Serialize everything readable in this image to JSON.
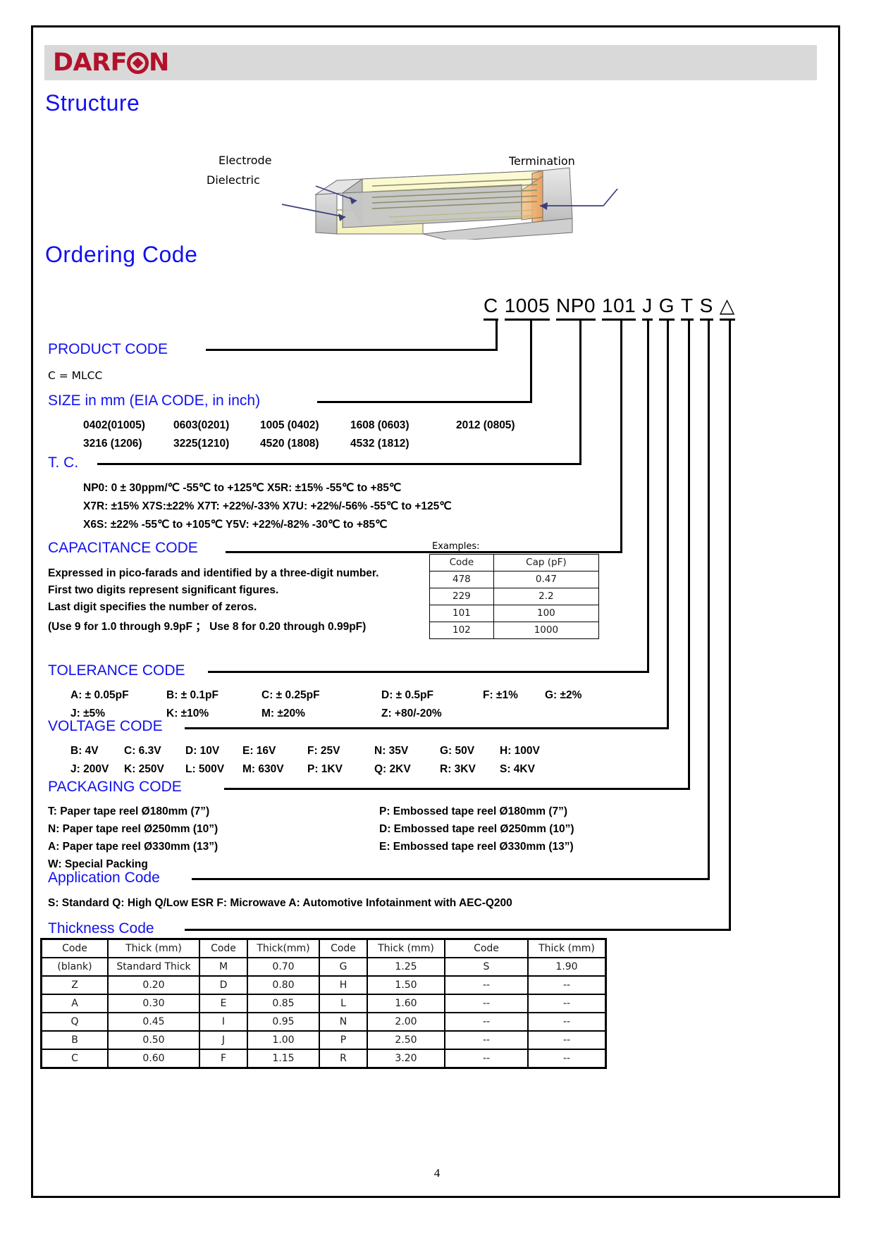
{
  "brand": {
    "name_part1": "DARF",
    "name_part2": "N"
  },
  "headings": {
    "structure": "Structure",
    "ordering_code": "Ordering Code"
  },
  "structure_diagram": {
    "labels": {
      "electrode": "Electrode",
      "dielectric": "Dielectric",
      "termination": "Termination"
    }
  },
  "ordering_code": {
    "segments": [
      "C",
      "1005",
      "NP0",
      "101",
      "J",
      "G",
      "T",
      "S",
      "△"
    ]
  },
  "sections": {
    "product_code": {
      "title": "PRODUCT CODE",
      "lines": [
        "C  =  MLCC"
      ]
    },
    "size": {
      "title": "SIZE in mm (EIA CODE, in inch)",
      "row1": [
        "0402(01005)",
        "0603(0201)",
        "1005 (0402)",
        "1608 (0603)",
        "2012 (0805)"
      ],
      "row2": [
        "3216 (1206)",
        "3225(1210)",
        "4520 (1808)",
        "4532 (1812)"
      ]
    },
    "tc": {
      "title": "T. C.",
      "line1": "NP0: 0 ± 30ppm/℃    -55℃  to +125℃          X5R: ±15%     -55℃  to +85℃",
      "line2": "X7R: ±15%    X7S:±22%   X7T: +22%/-33%   X7U: +22%/-56%    -55℃  to +125℃",
      "line3": "X6S: ±22%      -55℃  to +105℃        Y5V: +22%/-82%    -30℃  to +85℃"
    },
    "capacitance": {
      "title": "CAPACITANCE CODE",
      "line1": "Expressed in pico-farads and identified by a three-digit number.",
      "line2": "First two digits represent significant figures.",
      "line3": "Last digit specifies the number of zeros.",
      "line4": "(Use 9 for 1.0 through 9.9pF ；  Use 8 for 0.20 through 0.99pF)",
      "examples_caption": "Examples:",
      "examples_headers": [
        "Code",
        "Cap (pF)"
      ],
      "examples_rows": [
        [
          "478",
          "0.47"
        ],
        [
          "229",
          "2.2"
        ],
        [
          "101",
          "100"
        ],
        [
          "102",
          "1000"
        ]
      ]
    },
    "tolerance": {
      "title": "TOLERANCE CODE",
      "row1": [
        "A: ± 0.05pF",
        "B: ± 0.1pF",
        "C: ± 0.25pF",
        "D: ± 0.5pF",
        "F: ±1%",
        "G: ±2%"
      ],
      "row2": [
        "J: ±5%",
        "K: ±10%",
        "M: ±20%",
        "Z: +80/-20%"
      ]
    },
    "voltage": {
      "title": "VOLTAGE CODE",
      "row1": [
        "B: 4V",
        "C: 6.3V",
        "D: 10V",
        "E: 16V",
        "F: 25V",
        "N: 35V",
        "G: 50V",
        "H: 100V"
      ],
      "row2": [
        "J: 200V",
        "K: 250V",
        "L: 500V",
        "M: 630V",
        "P: 1KV",
        "Q: 2KV",
        "R: 3KV",
        "S: 4KV"
      ]
    },
    "packaging": {
      "title": "PACKAGING CODE",
      "left": [
        "T: Paper tape reel Ø180mm (7”)",
        "N: Paper tape reel Ø250mm (10”)",
        "A: Paper tape reel Ø330mm (13”)",
        "W: Special Packing"
      ],
      "right": [
        "P: Embossed tape reel Ø180mm (7”)",
        "D: Embossed tape reel Ø250mm (10”)",
        "E: Embossed tape reel Ø330mm (13”)"
      ]
    },
    "application": {
      "title": "Application Code",
      "line1": "S: Standard    Q: High Q/Low ESR   F: Microwave A: Automotive Infotainment with AEC-Q200"
    },
    "thickness": {
      "title": "Thickness Code",
      "headers": [
        "Code",
        "Thick (mm)",
        "Code",
        "Thick(mm)",
        "Code",
        "Thick (mm)",
        "Code",
        "Thick (mm)"
      ],
      "rows": [
        [
          "(blank)",
          "Standard Thick",
          "M",
          "0.70",
          "G",
          "1.25",
          "S",
          "1.90"
        ],
        [
          "Z",
          "0.20",
          "D",
          "0.80",
          "H",
          "1.50",
          "--",
          "--"
        ],
        [
          "A",
          "0.30",
          "E",
          "0.85",
          "L",
          "1.60",
          "--",
          "--"
        ],
        [
          "Q",
          "0.45",
          "I",
          "0.95",
          "N",
          "2.00",
          "--",
          "--"
        ],
        [
          "B",
          "0.50",
          "J",
          "1.00",
          "P",
          "2.50",
          "--",
          "--"
        ],
        [
          "C",
          "0.60",
          "F",
          "1.15",
          "R",
          "3.20",
          "--",
          "--"
        ]
      ]
    }
  },
  "footer": {
    "page_number": "4"
  },
  "colors": {
    "heading_blue": "#1111ee",
    "brand_red": "#b3112b",
    "band_gray": "#d9d9d9"
  }
}
